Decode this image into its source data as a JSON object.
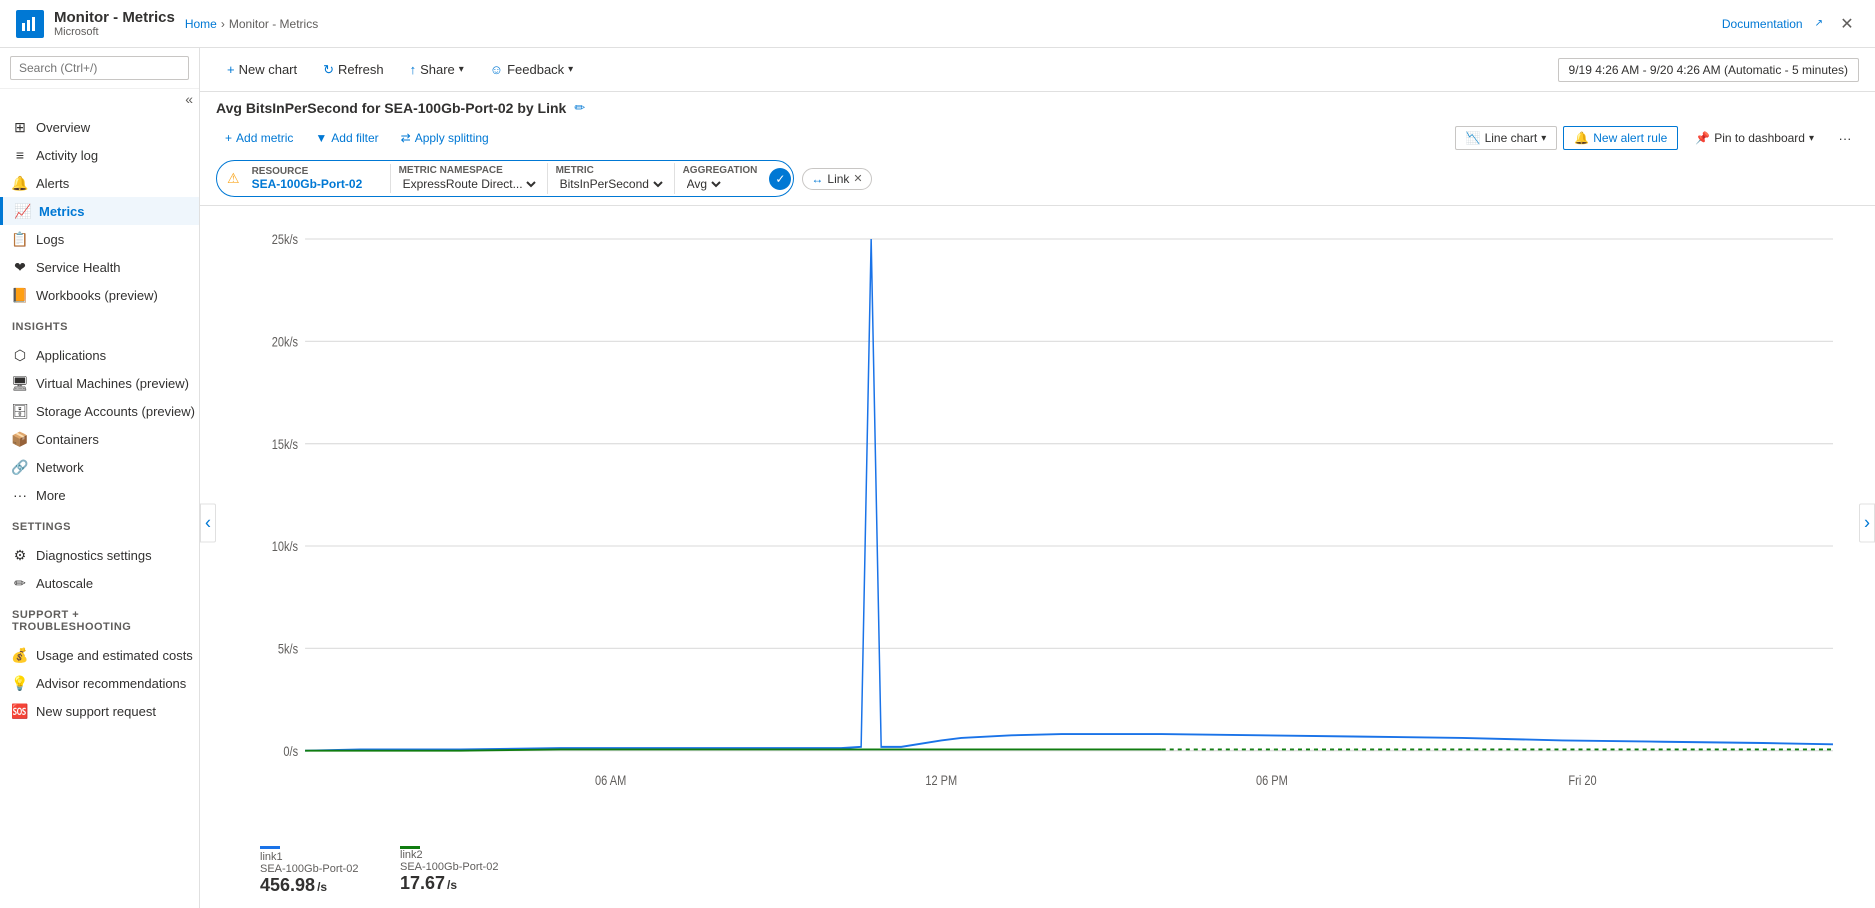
{
  "app": {
    "icon": "📊",
    "title": "Monitor - Metrics",
    "subtitle": "Microsoft",
    "breadcrumb_home": "Home",
    "breadcrumb_current": "Monitor - Metrics"
  },
  "top_right": {
    "doc_link": "Documentation",
    "close": "✕"
  },
  "sidebar": {
    "search_placeholder": "Search (Ctrl+/)",
    "items": [
      {
        "id": "overview",
        "label": "Overview",
        "icon": "⊞"
      },
      {
        "id": "activity-log",
        "label": "Activity log",
        "icon": "≡"
      },
      {
        "id": "alerts",
        "label": "Alerts",
        "icon": "🔔"
      },
      {
        "id": "metrics",
        "label": "Metrics",
        "icon": "📈",
        "active": true
      },
      {
        "id": "logs",
        "label": "Logs",
        "icon": "📋"
      },
      {
        "id": "service-health",
        "label": "Service Health",
        "icon": "❤"
      },
      {
        "id": "workbooks",
        "label": "Workbooks (preview)",
        "icon": "📙"
      }
    ],
    "insights_header": "Insights",
    "insights_items": [
      {
        "id": "applications",
        "label": "Applications",
        "icon": "⬡"
      },
      {
        "id": "virtual-machines",
        "label": "Virtual Machines (preview)",
        "icon": "🖥"
      },
      {
        "id": "storage-accounts",
        "label": "Storage Accounts (preview)",
        "icon": "🗄"
      },
      {
        "id": "containers",
        "label": "Containers",
        "icon": "📦"
      },
      {
        "id": "network",
        "label": "Network",
        "icon": "🔗"
      },
      {
        "id": "more",
        "label": "More",
        "icon": "···"
      }
    ],
    "settings_header": "Settings",
    "settings_items": [
      {
        "id": "diagnostics-settings",
        "label": "Diagnostics settings",
        "icon": "⚙"
      },
      {
        "id": "autoscale",
        "label": "Autoscale",
        "icon": "✏"
      }
    ],
    "support_header": "Support + Troubleshooting",
    "support_items": [
      {
        "id": "usage-costs",
        "label": "Usage and estimated costs",
        "icon": "💰"
      },
      {
        "id": "advisor",
        "label": "Advisor recommendations",
        "icon": "💡"
      },
      {
        "id": "new-support",
        "label": "New support request",
        "icon": "🆘"
      }
    ]
  },
  "toolbar": {
    "new_chart": "New chart",
    "refresh": "Refresh",
    "share": "Share",
    "feedback": "Feedback",
    "time_range": "9/19 4:26 AM - 9/20 4:26 AM (Automatic - 5 minutes)"
  },
  "chart": {
    "title": "Avg BitsInPerSecond for SEA-100Gb-Port-02 by Link",
    "add_metric": "Add metric",
    "add_filter": "Add filter",
    "apply_splitting": "Apply splitting",
    "chart_type": "Line chart",
    "new_alert_rule": "New alert rule",
    "pin_to_dashboard": "Pin to dashboard",
    "more": "···",
    "resource_label": "RESOURCE",
    "resource_value": "SEA-100Gb-Port-02",
    "namespace_label": "METRIC NAMESPACE",
    "namespace_value": "ExpressRoute Direct...",
    "metric_label": "METRIC",
    "metric_value": "BitsInPerSecond",
    "aggregation_label": "AGGREGATION",
    "aggregation_value": "Avg",
    "link_tag": "Link",
    "y_axis": {
      "labels": [
        "25k/s",
        "20k/s",
        "15k/s",
        "10k/s",
        "5k/s",
        "0/s"
      ]
    },
    "x_axis": {
      "labels": [
        "06 AM",
        "12 PM",
        "06 PM",
        "Fri 20"
      ]
    },
    "legend": [
      {
        "id": "link1",
        "label": "link1",
        "sublabel": "SEA-100Gb-Port-02",
        "value": "456.98",
        "unit": "/s",
        "color": "#1a73e8"
      },
      {
        "id": "link2",
        "label": "link2",
        "sublabel": "SEA-100Gb-Port-02",
        "value": "17.67",
        "unit": "/s",
        "color": "#107c10"
      }
    ]
  }
}
